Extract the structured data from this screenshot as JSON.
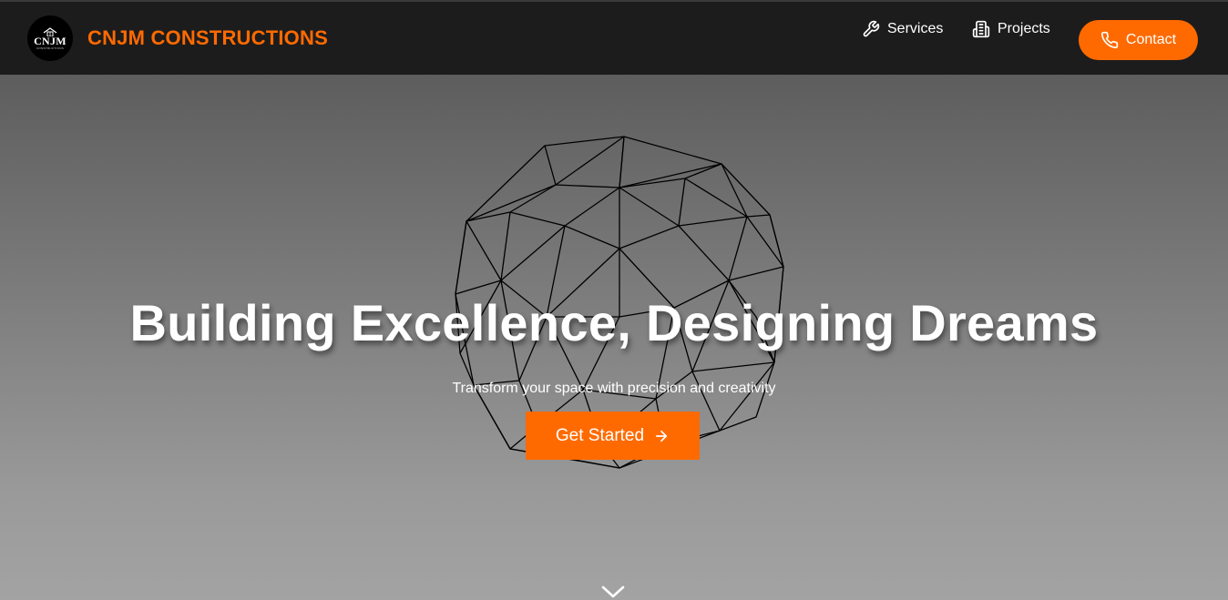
{
  "brand": {
    "logo_text": "CNJM",
    "logo_sub": "CONSTRUCTIONS",
    "name": "CNJM CONSTRUCTIONS"
  },
  "nav": {
    "items": [
      {
        "label": "Services",
        "icon": "wrench-icon"
      },
      {
        "label": "Projects",
        "icon": "building-icon"
      }
    ],
    "contact_label": "Contact",
    "contact_icon": "phone-icon"
  },
  "hero": {
    "title": "Building Excellence, Designing Dreams",
    "subtitle": "Transform your space with precision and creativity",
    "cta_label": "Get Started",
    "cta_icon": "arrow-right-icon",
    "scroll_icon": "chevron-down-icon"
  },
  "colors": {
    "accent": "#ff6a00",
    "navbar": "#1c1c1c",
    "hero_top": "#5d5d5d",
    "hero_bottom": "#a3a3a3"
  }
}
